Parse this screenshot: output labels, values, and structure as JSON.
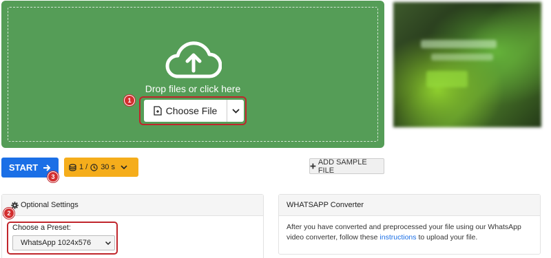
{
  "upload": {
    "drop_text": "Drop files or click here",
    "choose_file_label": "Choose File",
    "icon": "cloud-upload-icon"
  },
  "annotations": [
    "1",
    "2",
    "3"
  ],
  "actions": {
    "start_label": "START",
    "limits": {
      "files": "1",
      "separator": "/",
      "duration": "30 s"
    },
    "add_sample_label": "ADD SAMPLE FILE"
  },
  "settings": {
    "title": "Optional Settings",
    "preset_label": "Choose a Preset:",
    "preset_value": "WhatsApp 1024x576"
  },
  "info": {
    "title": "WHATSAPP Converter",
    "text_before": "After you have converted and preprocessed your file using our WhatsApp video converter, follow these",
    "link_text": "instructions",
    "text_after": "to upload your file."
  },
  "colors": {
    "dropzone": "#559d57",
    "start": "#1b6fe6",
    "limits": "#f5ad1b",
    "highlight": "#c0252b"
  }
}
